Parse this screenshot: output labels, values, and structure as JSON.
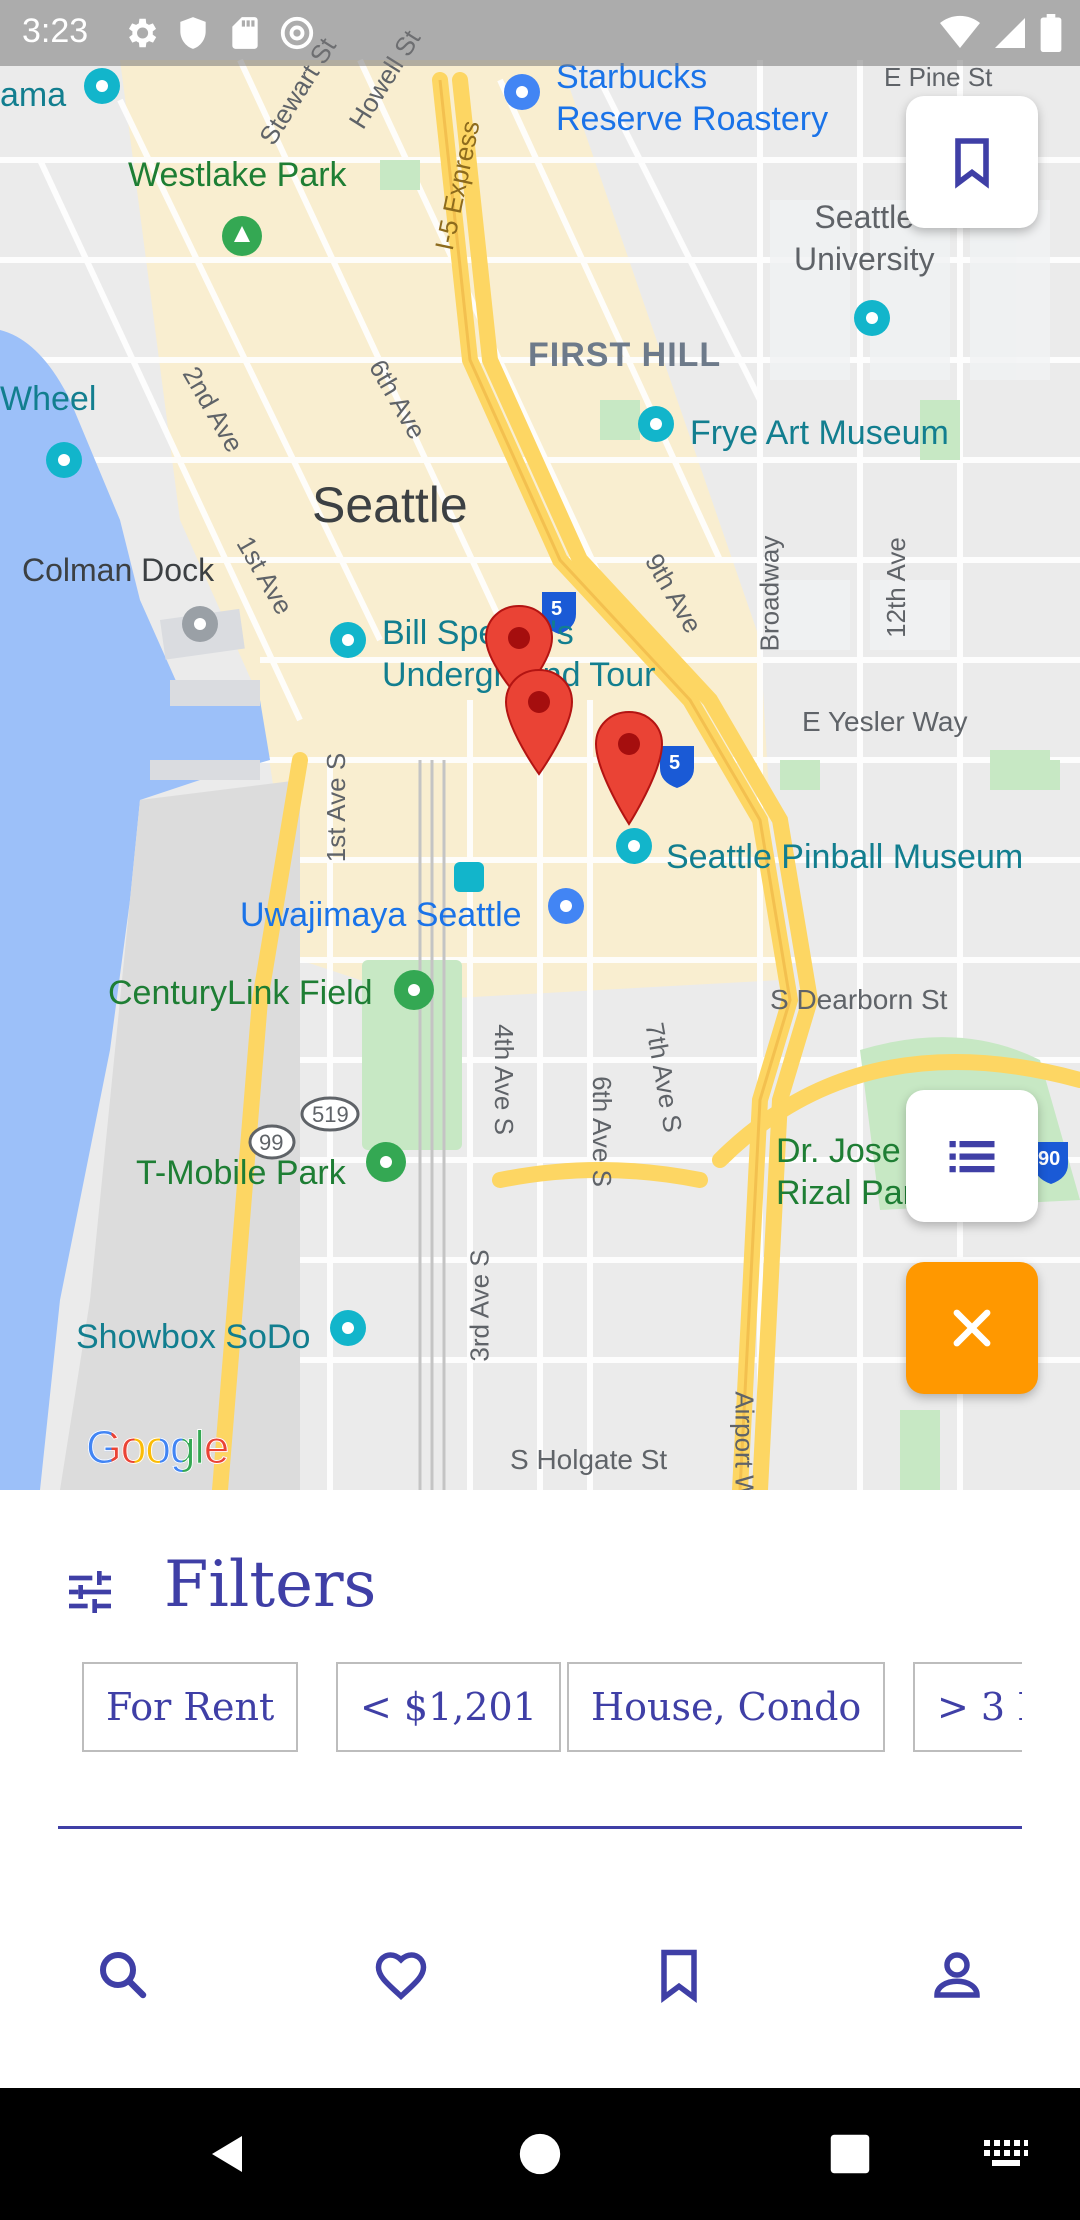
{
  "status_bar": {
    "time": "3:23",
    "icons": [
      "gear-icon",
      "shield-icon",
      "sd-card-icon",
      "at-sign-icon",
      "wifi-icon",
      "signal-icon",
      "battery-icon"
    ]
  },
  "map": {
    "labels": {
      "starbucks": "Starbucks\nReserve Roastery",
      "pine": "E Pine St",
      "westlake": "Westlake Park",
      "seattle_u": "Seattle\nUniversity",
      "first_hill": "FIRST HILL",
      "frye": "Frye Art Museum",
      "wheel": "Wheel",
      "seattle": "Seattle",
      "colman": "Colman Dock",
      "bill_speidel": "Bill Speidel's\nUnderground Tour",
      "yesler": "E Yesler Way",
      "pinball": "Seattle Pinball Museum",
      "uwajimaya": "Uwajimaya Seattle",
      "centurylink": "CenturyLink Field",
      "dearborn": "S Dearborn St",
      "rizal": "Dr. Jose\nRizal Park",
      "tmobile": "T-Mobile Park",
      "showbox": "Showbox SoDo",
      "holgate": "S Holgate St",
      "ama": "ama",
      "stewart": "Stewart St",
      "howell": "Howell St",
      "i5_express": "I-5 Express",
      "second_ave": "2nd Ave",
      "sixth_ave": "6th Ave",
      "first_ave": "1st Ave",
      "ninth_ave": "9th Ave",
      "broadway": "Broadway",
      "twelfth_ave": "12th Ave",
      "first_ave_s": "1st Ave S",
      "fourth_ave_s": "4th Ave S",
      "sixth_ave_s": "6th Ave S",
      "seventh_ave_s": "7th Ave S",
      "third_ave_s": "3rd Ave S",
      "airport_way": "Airport W",
      "i5_a": "5",
      "i5_b": "5",
      "r519": "519",
      "r99": "99",
      "i90": "90"
    },
    "markers_count": 3,
    "attribution": "Google"
  },
  "fabs": {
    "bookmark": "bookmark-icon",
    "list": "list-icon",
    "close": "close-icon"
  },
  "sheet": {
    "title": "Filters",
    "chips": [
      "For Rent",
      "< $1,201",
      "House, Condo",
      "> 3 R"
    ]
  },
  "bottom_nav": [
    "search-icon",
    "heart-icon",
    "bookmark-icon",
    "person-icon"
  ],
  "colors": {
    "accent": "#3f3fa6",
    "fab_orange": "#ff9800",
    "marker_red": "#ea4335",
    "water": "#9cc0f9",
    "park": "#c7e8c4",
    "highway": "#fdd663"
  }
}
